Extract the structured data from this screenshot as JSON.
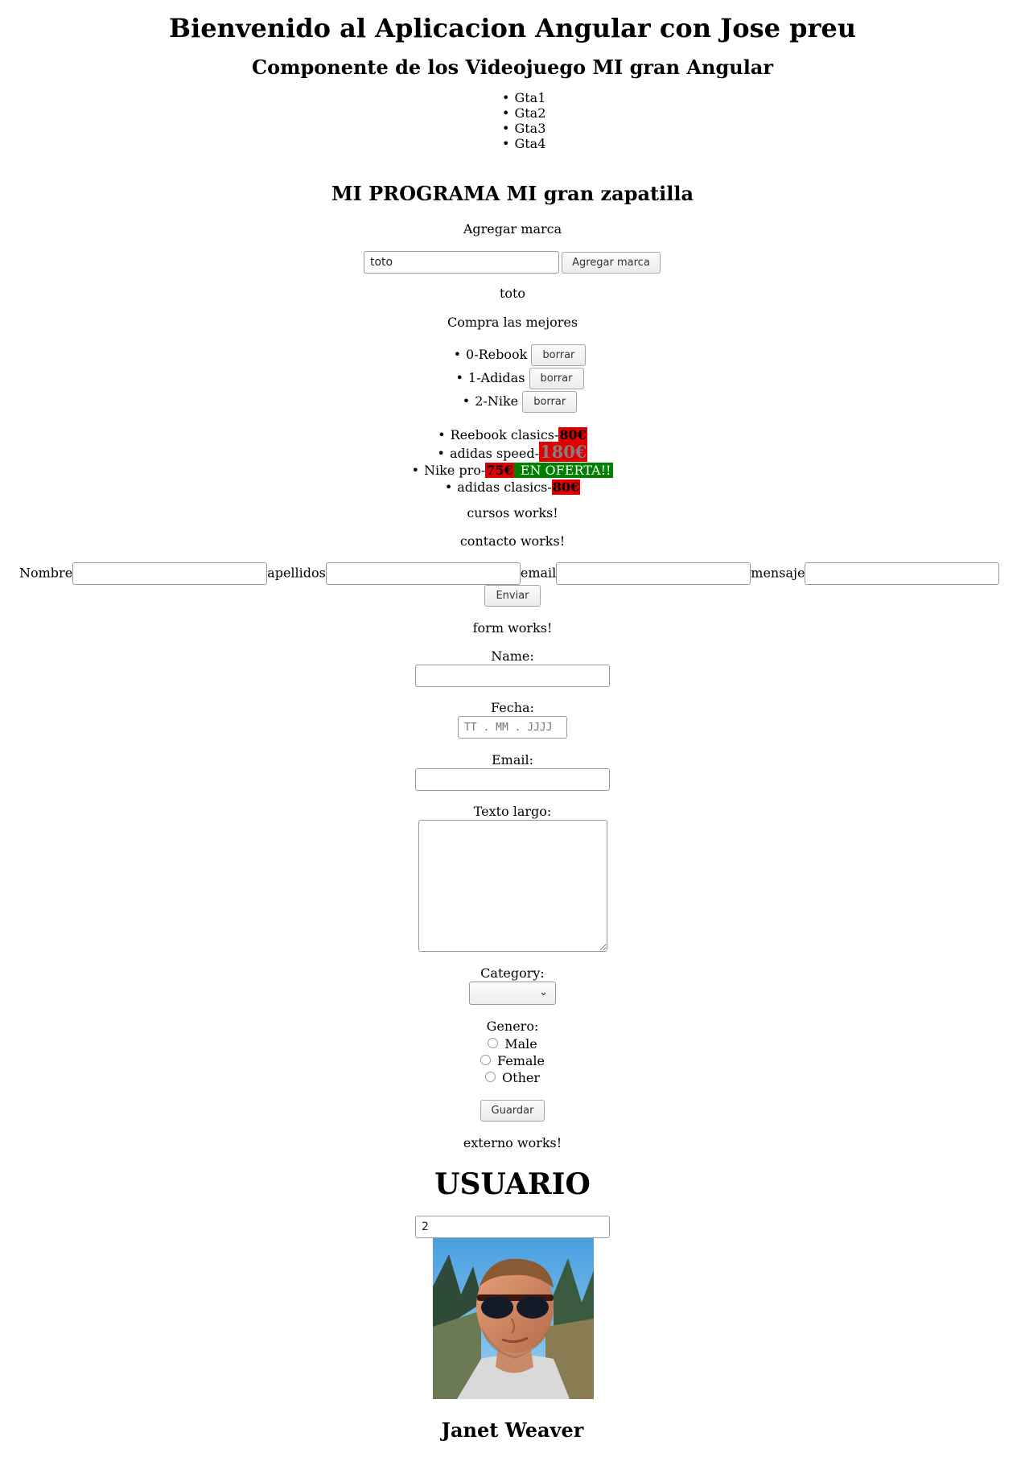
{
  "header": {
    "title": "Bienvenido al Aplicacion Angular con Jose preu"
  },
  "videojuegos": {
    "title": "Componente de los Videojuego MI gran Angular",
    "items": [
      "Gta1",
      "Gta2",
      "Gta3",
      "Gta4"
    ]
  },
  "zapatillas": {
    "title": "MI PROGRAMA MI gran zapatilla",
    "agregar_label": "Agregar marca",
    "marca_input_value": "toto",
    "agregar_button": "Agregar marca",
    "echo_value": "toto",
    "compra_text": "Compra las mejores",
    "marcas": [
      {
        "label": "0-Rebook",
        "button": "borrar"
      },
      {
        "label": "1-Adidas",
        "button": "borrar"
      },
      {
        "label": "2-Nike",
        "button": "borrar"
      }
    ],
    "productos": [
      {
        "name": "Reebook clasics-",
        "price": "80€"
      },
      {
        "name": "adidas speed-",
        "price": "180€"
      },
      {
        "name": "Nike pro-",
        "price": "75€",
        "offer": " EN OFERTA!!"
      },
      {
        "name": "adidas clasics-",
        "price": "80€"
      }
    ],
    "colors": {
      "price_bg": "#e00000",
      "offer_bg": "#008000"
    }
  },
  "cursos": {
    "text": "cursos works!"
  },
  "contacto": {
    "text": "contacto works!",
    "labels": {
      "nombre": "Nombre",
      "apellidos": "apellidos",
      "email": "email",
      "mensaje": "mensaje"
    },
    "send_button": "Enviar"
  },
  "form": {
    "text": "form works!",
    "name_label": "Name:",
    "fecha_label": "Fecha:",
    "fecha_placeholder": "TT . MM . JJJJ",
    "email_label": "Email:",
    "texto_label": "Texto largo:",
    "category_label": "Category:",
    "genero_label": "Genero:",
    "genero_options": [
      "Male",
      "Female",
      "Other"
    ],
    "save_button": "Guardar"
  },
  "externo": {
    "text": "externo works!",
    "usuario_title": "USUARIO",
    "user_id_value": "2",
    "user_name": "Janet Weaver"
  }
}
